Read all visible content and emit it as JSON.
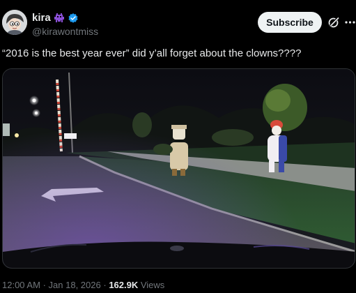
{
  "author": {
    "display_name": "kira",
    "handle": "@kirawontmiss",
    "avatar_icon": "cartoon-avatar",
    "badge_icon": "alien-monster-emoji",
    "verified_icon": "verified-checkmark",
    "verified_color": "#1d9bf0"
  },
  "actions": {
    "subscribe_label": "Subscribe",
    "grok_icon": "grok-icon",
    "more_icon": "more-dots-icon"
  },
  "tweet": {
    "text": "“2016 is the best year ever” did y’all forget about the clowns????"
  },
  "media": {
    "type": "video-still",
    "description_icon": "dashcam-photo"
  },
  "meta": {
    "time": "12:00 AM",
    "separator": "·",
    "date": "Jan 18, 2026",
    "views_count": "162.9K",
    "views_label": "Views"
  },
  "colors": {
    "background": "#000000",
    "text_primary": "#e7e9ea",
    "text_secondary": "#71767b",
    "button_bg": "#eff3f4"
  }
}
